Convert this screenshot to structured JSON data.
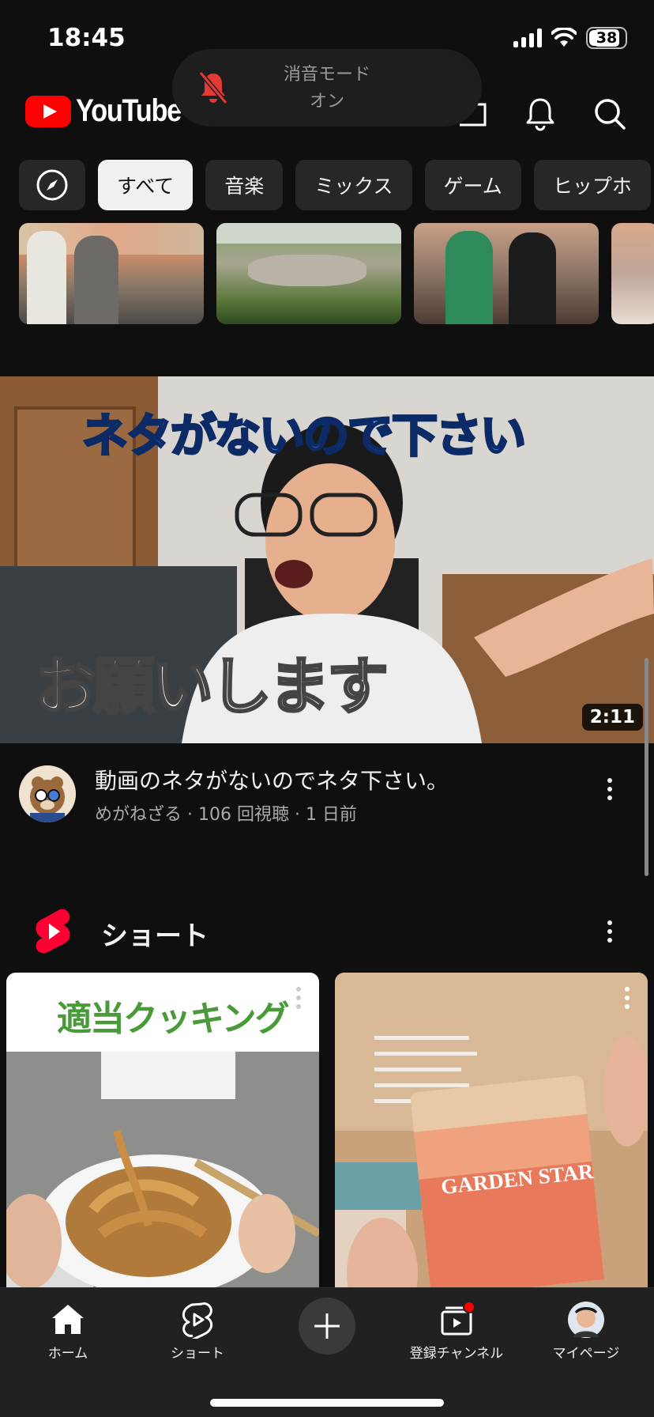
{
  "status_bar": {
    "time": "18:45",
    "battery": "38"
  },
  "silent_toast": {
    "line1": "消音モード",
    "line2": "オン"
  },
  "header": {
    "logo_text": "YouTube"
  },
  "chips": [
    "すべて",
    "音楽",
    "ミックス",
    "ゲーム",
    "ヒップホ"
  ],
  "video": {
    "overlay_top": "ネタがないので下さい",
    "overlay_bottom": "お願いします",
    "duration": "2:11",
    "title": "動画のネタがないのでネタ下さい。",
    "meta": "めがねざる · 106 回視聴 · 1 日前"
  },
  "shorts": {
    "title": "ショート",
    "cards": [
      {
        "banner_text": "適当クッキング"
      },
      {
        "box_text": "GARDEN STAR"
      }
    ]
  },
  "bottom_nav": {
    "home": "ホーム",
    "shorts": "ショート",
    "subscriptions": "登録チャンネル",
    "mypage": "マイページ"
  },
  "colors": {
    "accent": "#ff0000",
    "background": "#0f0f0f",
    "chip_active": "#f1f1f1"
  }
}
